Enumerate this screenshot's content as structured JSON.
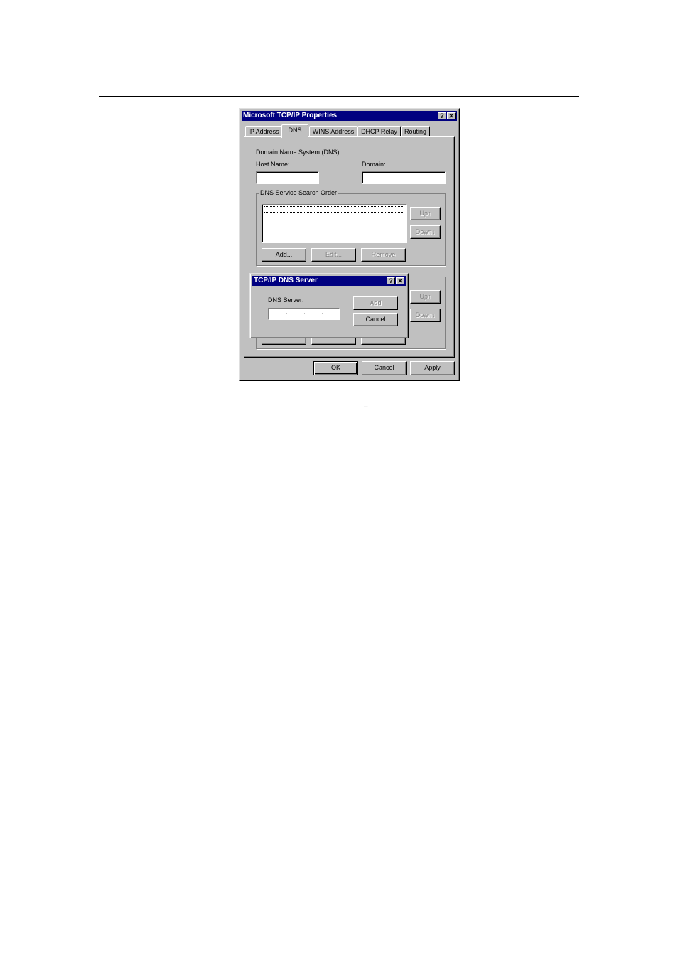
{
  "main_dialog": {
    "title": "Microsoft TCP/IP Properties",
    "help_glyph": "?",
    "close_glyph": "✕",
    "tabs": [
      {
        "label": "IP Address"
      },
      {
        "label": "DNS"
      },
      {
        "label": "WINS Address"
      },
      {
        "label": "DHCP Relay"
      },
      {
        "label": "Routing"
      }
    ],
    "active_tab": "DNS",
    "section_label": "Domain Name System (DNS)",
    "host_name_label": "Host Name:",
    "host_name_value": "",
    "domain_label": "Domain:",
    "domain_value": "",
    "dns_group_label": "DNS Service Search Order",
    "up_label": "Up↑",
    "down_label": "Down↓",
    "add_label": "Add...",
    "edit_label": "Edit...",
    "remove_label": "Remove",
    "ok_label": "OK",
    "cancel_label": "Cancel",
    "apply_label": "Apply"
  },
  "dns_server_dialog": {
    "title": "TCP/IP DNS Server",
    "help_glyph": "?",
    "close_glyph": "✕",
    "dns_server_label": "DNS Server:",
    "dns_server_value": "",
    "add_label": "Add",
    "cancel_label": "Cancel"
  },
  "page": {
    "caption_mark": "–"
  }
}
